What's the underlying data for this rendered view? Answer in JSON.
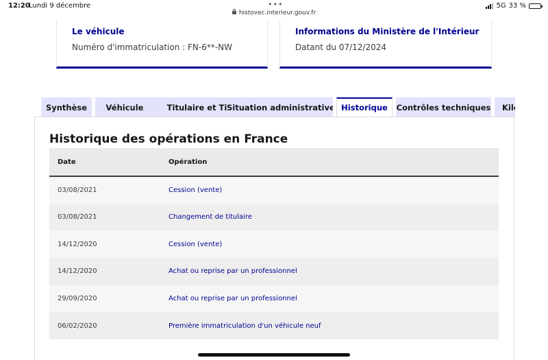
{
  "status_bar": {
    "time": "12:20",
    "date": "Lundi 9 décembre",
    "url": "histovec.interieur.gouv.fr",
    "network": "5G",
    "battery": "33 %",
    "battery_level": 0.33
  },
  "cards": [
    {
      "title": "Le véhicule",
      "text": "Numéro d'immatriculation : FN-6**-NW"
    },
    {
      "title": "Informations du Ministère de l'Intérieur",
      "text": "Datant du 07/12/2024"
    }
  ],
  "tabs": [
    {
      "label": "Synthèse"
    },
    {
      "label": "Véhicule"
    },
    {
      "label": "Titulaire et Titre"
    },
    {
      "label": "Situation administrative"
    },
    {
      "label": "Historique"
    },
    {
      "label": "Contrôles techniques"
    },
    {
      "label": "Kilométrage"
    }
  ],
  "active_tab": "Historique",
  "history": {
    "title": "Historique des opérations en France",
    "columns": [
      "Date",
      "Opération"
    ],
    "rows": [
      {
        "date": "03/08/2021",
        "operation": "Cession (vente)"
      },
      {
        "date": "03/08/2021",
        "operation": "Changement de titulaire"
      },
      {
        "date": "14/12/2020",
        "operation": "Cession (vente)"
      },
      {
        "date": "14/12/2020",
        "operation": "Achat ou reprise par un professionnel"
      },
      {
        "date": "29/09/2020",
        "operation": "Achat ou reprise par un professionnel"
      },
      {
        "date": "06/02/2020",
        "operation": "Première immatriculation d'un véhicule neuf"
      }
    ]
  },
  "colors": {
    "brand_blue": "#000091",
    "tab_background": "#e3e3fd"
  }
}
